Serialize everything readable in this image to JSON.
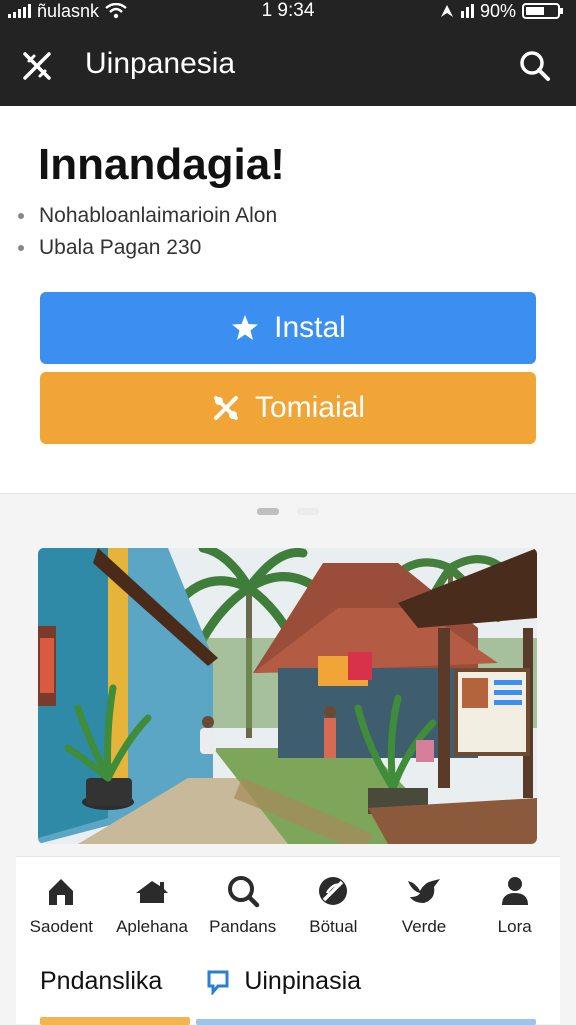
{
  "status_bar": {
    "carrier": "ñulasnk",
    "time": "1 9:34",
    "battery_text": "90%"
  },
  "app_bar": {
    "title": "Uinpanesia",
    "menu_icon": "tools-icon",
    "search_icon": "search-icon"
  },
  "hero": {
    "headline": "Innandagia!",
    "bullets": [
      "Nohabloanlaimarioin Alon",
      "Ubala Pagan 230"
    ]
  },
  "buttons": {
    "install": {
      "label": "Instal",
      "icon": "star-icon",
      "color": "#3b8ff0"
    },
    "tutorial": {
      "label": "Tomiaial",
      "icon": "tools-icon",
      "color": "#f2a537"
    }
  },
  "pager": {
    "count": 2,
    "active_index": 0
  },
  "nav": {
    "items": [
      {
        "label": "Saodent",
        "icon": "home-icon"
      },
      {
        "label": "Aplehana",
        "icon": "house-roof-icon"
      },
      {
        "label": "Pandans",
        "icon": "search-icon"
      },
      {
        "label": "Bötual",
        "icon": "no-feather-icon"
      },
      {
        "label": "Verde",
        "icon": "bird-icon"
      },
      {
        "label": "Lora",
        "icon": "person-icon"
      }
    ]
  },
  "footer": {
    "title": "Pndanslika",
    "link_label": "Uinpinasia",
    "link_icon": "chat-icon"
  }
}
